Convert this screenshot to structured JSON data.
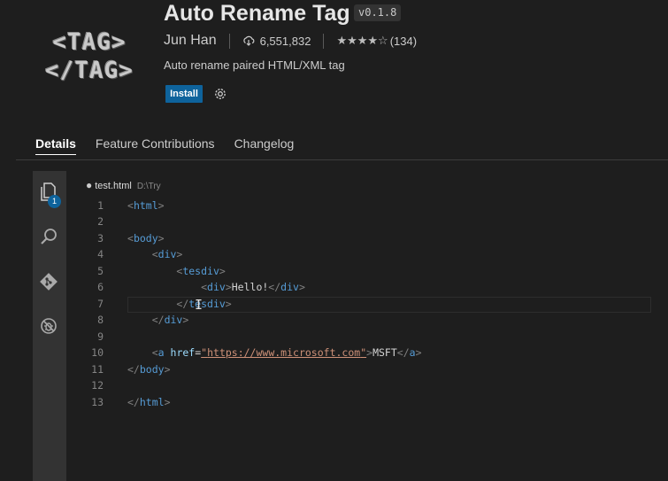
{
  "extension": {
    "logo_lines": [
      "<TAG>",
      "</TAG>"
    ],
    "title": "Auto Rename Tag",
    "version": "v0.1.8",
    "author": "Jun Han",
    "installs": "6,551,832",
    "rating_stars": "★★★★☆",
    "rating_count": "(134)",
    "description": "Auto rename paired HTML/XML tag",
    "install_label": "Install"
  },
  "tabs": [
    {
      "label": "Details",
      "active": true
    },
    {
      "label": "Feature Contributions",
      "active": false
    },
    {
      "label": "Changelog",
      "active": false
    }
  ],
  "editor": {
    "dirty_marker": "●",
    "file_name": "test.html",
    "file_path": "D:\\Try",
    "explorer_badge": "1",
    "lines": [
      {
        "n": "1"
      },
      {
        "n": "2"
      },
      {
        "n": "3"
      },
      {
        "n": "4"
      },
      {
        "n": "5"
      },
      {
        "n": "6"
      },
      {
        "n": "7"
      },
      {
        "n": "8"
      },
      {
        "n": "9"
      },
      {
        "n": "10"
      },
      {
        "n": "11"
      },
      {
        "n": "12"
      },
      {
        "n": "13"
      }
    ],
    "code": {
      "l1": "html",
      "l3": "body",
      "l4": "div",
      "l5": "tesdiv",
      "l6_open": "div",
      "l6_text": "Hello!",
      "l6_close": "div",
      "l7": "tesdiv",
      "l8": "div",
      "l10_tag": "a",
      "l10_attr": "href",
      "l10_url": "https://www.microsoft.com",
      "l10_text": "MSFT",
      "l10_close": "a",
      "l11": "body",
      "l13": "html"
    }
  },
  "colors": {
    "install_button": "#0e639c",
    "tag_name": "#569cd6",
    "attribute": "#9cdcfe",
    "string": "#ce9178"
  },
  "icons": [
    "download-icon",
    "gear-icon",
    "explorer-icon",
    "search-icon",
    "source-control-icon",
    "debug-icon",
    "text-cursor-icon"
  ]
}
